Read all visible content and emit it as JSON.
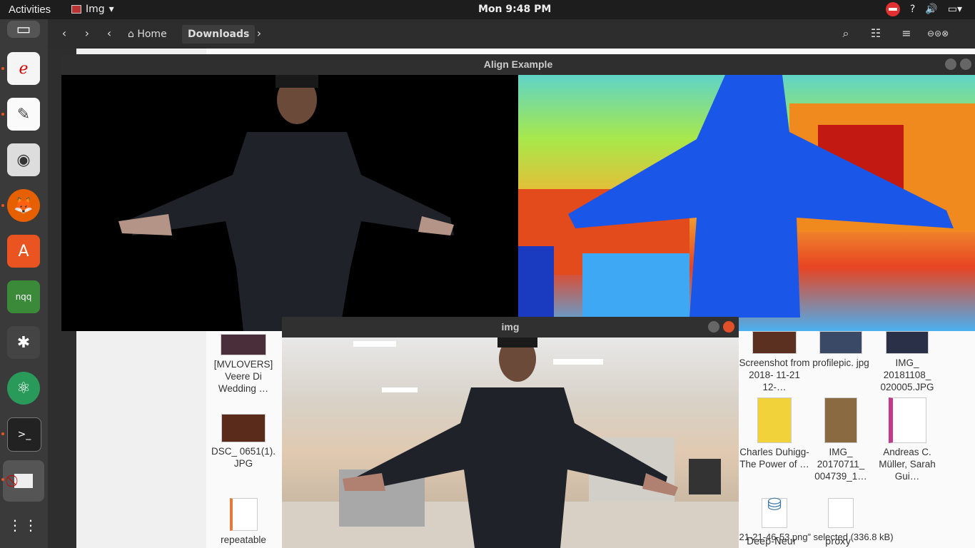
{
  "topbar": {
    "activities": "Activities",
    "app_name": "Img",
    "clock": "Mon  9:48 PM"
  },
  "files": {
    "crumbs": {
      "home": "Home",
      "current": "Downloads"
    },
    "items": [
      {
        "label": "[MVLOVERS] Veere Di Wedding …"
      },
      {
        "label": "DSC_ 0651(1). JPG"
      },
      {
        "label": "repeatable"
      },
      {
        "label": "Screenshot from 2018- 11-21 12-…"
      },
      {
        "label": "profilepic. jpg"
      },
      {
        "label": "IMG_ 20181108_ 020005.JPG"
      },
      {
        "label": "Charles Duhigg-The Power of …"
      },
      {
        "label": "IMG_ 20170711_ 004739_1…"
      },
      {
        "label": "Andreas C. Müller, Sarah Gui…"
      }
    ],
    "status": "m 2019-01-21-21-46-53.png” selected  (336.8 kB)",
    "partial_names": {
      "deep": "Deep-Neur",
      "proxy": "proxy"
    }
  },
  "align_window": {
    "title": "Align Example"
  },
  "img_window": {
    "title": "img"
  },
  "colors": {
    "topbar": "#1d1d1d",
    "dock": "#3a3a3a",
    "accent": "#e95420",
    "close": "#e2502a"
  }
}
